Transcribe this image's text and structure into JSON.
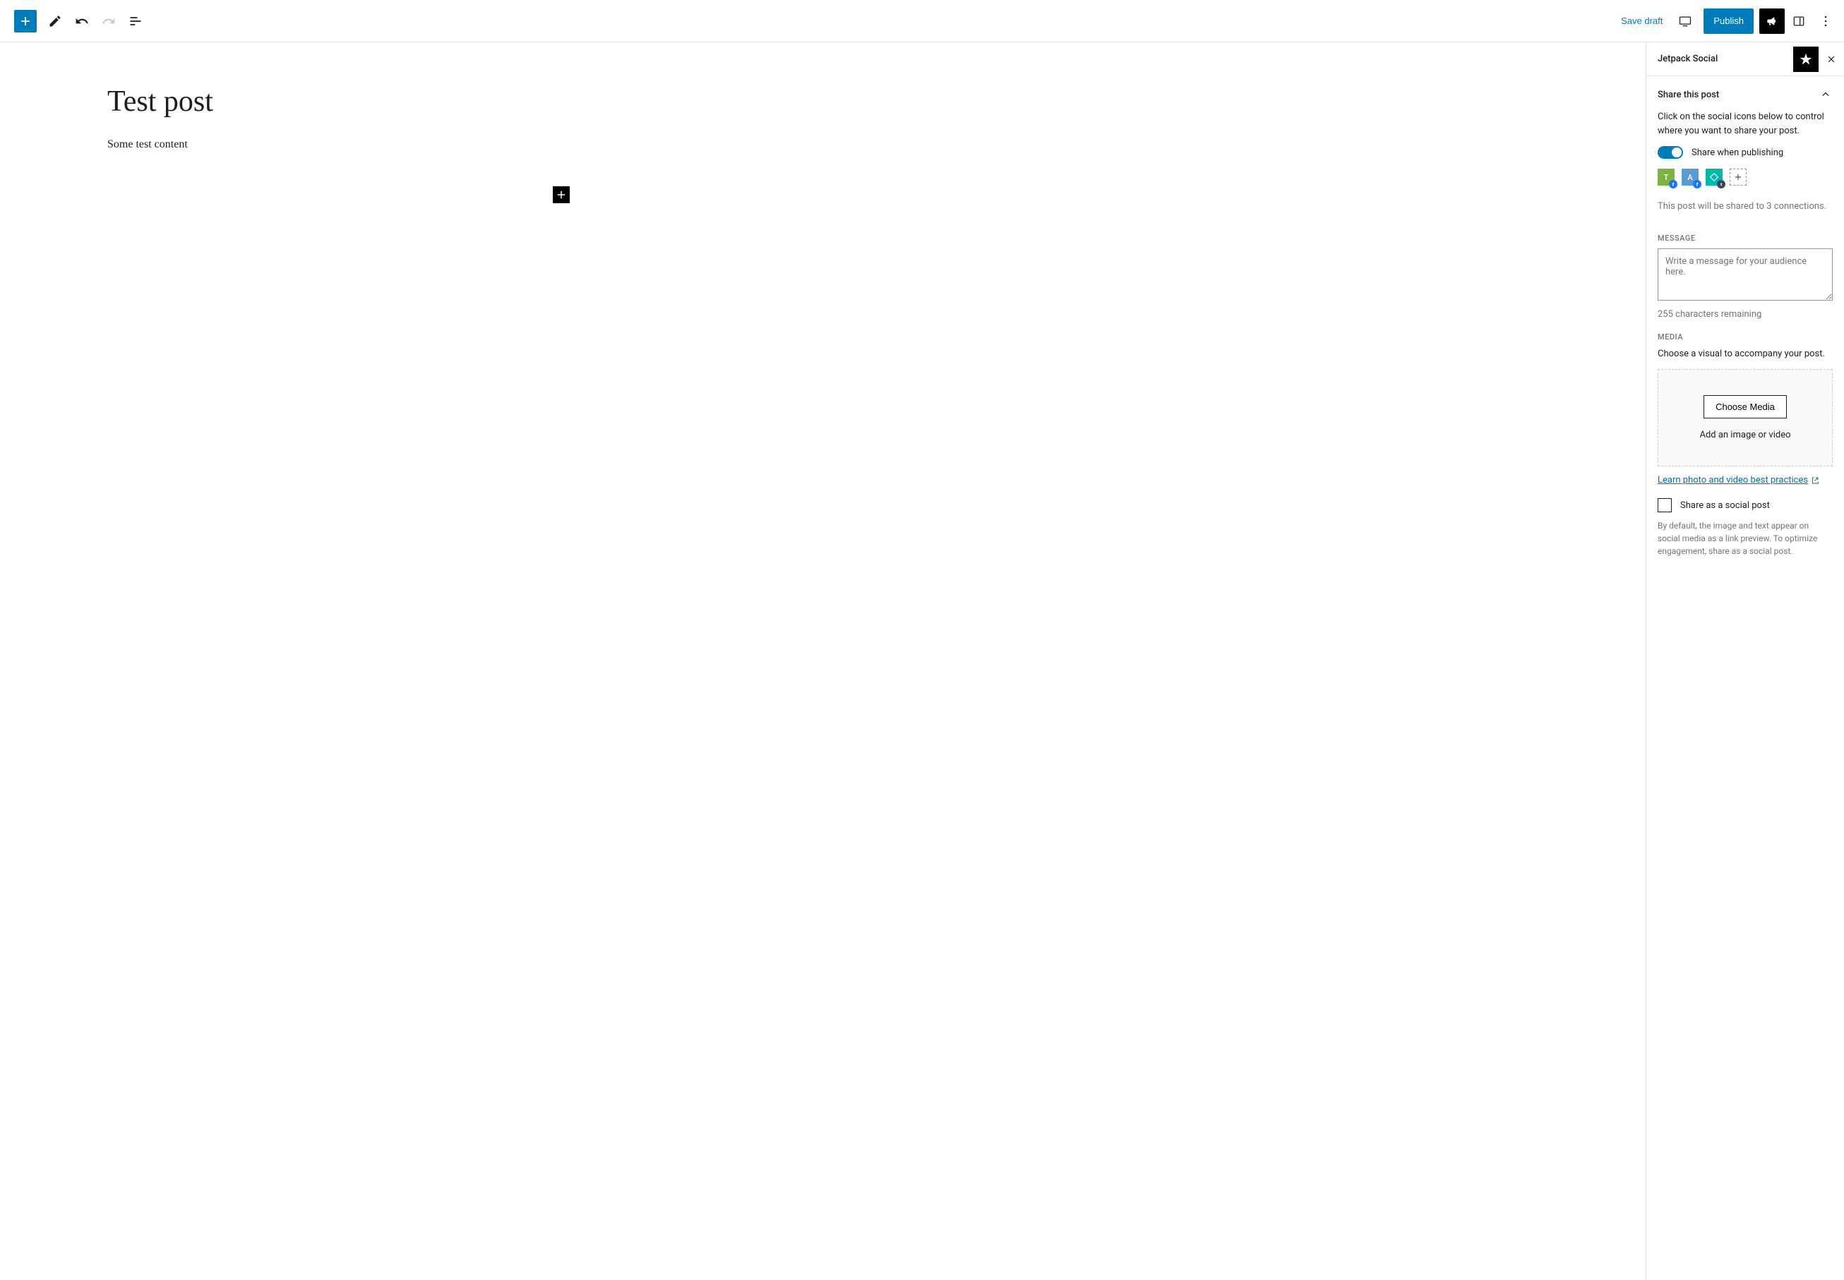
{
  "toolbar": {
    "save_draft_label": "Save draft",
    "publish_label": "Publish"
  },
  "editor": {
    "title": "Test post",
    "body": "Some test content"
  },
  "sidebar": {
    "title": "Jetpack Social",
    "share_section": {
      "title": "Share this post",
      "description": "Click on the social icons below to control where you want to share your post.",
      "toggle_label": "Share when publishing",
      "toggle_on": true,
      "connections_text": "This post will be shared to 3 connections.",
      "social_accounts": [
        {
          "letter": "T",
          "bg": "#7cb342",
          "badge_bg": "#1877f2"
        },
        {
          "letter": "A",
          "bg": "#5b9bd5",
          "badge_bg": "#1877f2"
        },
        {
          "letter": "",
          "bg": "#00b8a9",
          "badge_bg": "#36465d"
        }
      ]
    },
    "message_section": {
      "label": "MESSAGE",
      "placeholder": "Write a message for your audience here.",
      "char_remaining": "255 characters remaining"
    },
    "media_section": {
      "label": "MEDIA",
      "description": "Choose a visual to accompany your post.",
      "choose_button": "Choose Media",
      "hint": "Add an image or video",
      "learn_link": "Learn photo and video best practices"
    },
    "social_post_section": {
      "checkbox_label": "Share as a social post",
      "description": "By default, the image and text appear on social media as a link preview. To optimize engagement, share as a social post."
    }
  }
}
